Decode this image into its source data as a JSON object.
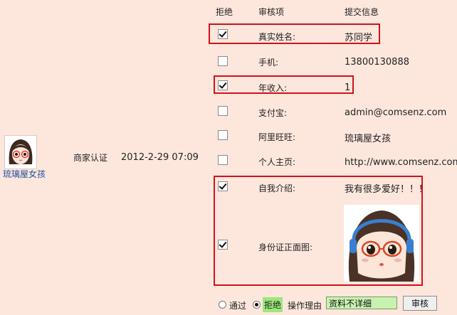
{
  "headers": {
    "reject": "拒绝",
    "item": "审核项",
    "info": "提交信息"
  },
  "user": {
    "name": "琉璃屋女孩"
  },
  "apply": {
    "type": "商家认证",
    "date": "2012-2-29 07:09"
  },
  "rows": [
    {
      "label": "真实姓名:",
      "value": "苏同学",
      "checked": true
    },
    {
      "label": "手机:",
      "value": "13800130888",
      "checked": false
    },
    {
      "label": "年收入:",
      "value": "1",
      "checked": true
    },
    {
      "label": "支付宝:",
      "value": "admin@comsenz.com",
      "checked": false
    },
    {
      "label": "阿里旺旺:",
      "value": "琉璃屋女孩",
      "checked": false
    },
    {
      "label": "个人主页:",
      "value": "http://www.comsenz.com",
      "checked": false
    },
    {
      "label": "自我介绍:",
      "value": "我有很多爱好！！！",
      "checked": true
    },
    {
      "label": "身份证正面图:",
      "value": "",
      "checked": true
    }
  ],
  "actions": {
    "pass": "通过",
    "reject": "拒绝",
    "reason_label": "操作理由",
    "reason_value": "资料不详细",
    "submit": "审核"
  },
  "colors": {
    "highlight": "#d1111b",
    "reject_bg": "#9be87a"
  }
}
